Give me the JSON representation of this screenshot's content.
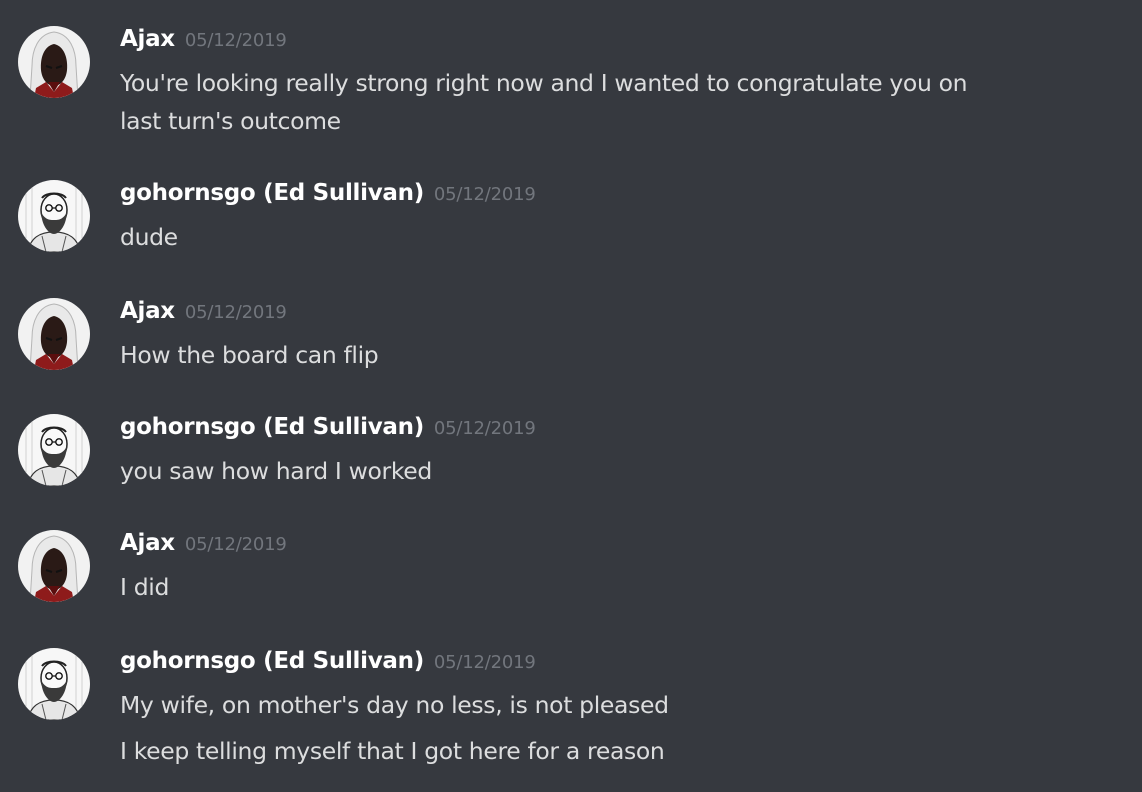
{
  "messages": [
    {
      "author": "Ajax",
      "avatar_icon": "hooded-assassin-avatar",
      "timestamp": "05/12/2019",
      "lines": [
        "You're looking really strong right now and I wanted to congratulate you on",
        "last turn's outcome"
      ]
    },
    {
      "author": "gohornsgo (Ed Sullivan)",
      "avatar_icon": "bearded-man-sketch-avatar",
      "timestamp": "05/12/2019",
      "lines": [
        "dude"
      ]
    },
    {
      "author": "Ajax",
      "avatar_icon": "hooded-assassin-avatar",
      "timestamp": "05/12/2019",
      "lines": [
        "How the board can flip"
      ]
    },
    {
      "author": "gohornsgo (Ed Sullivan)",
      "avatar_icon": "bearded-man-sketch-avatar",
      "timestamp": "05/12/2019",
      "lines": [
        "you saw how hard I worked"
      ]
    },
    {
      "author": "Ajax",
      "avatar_icon": "hooded-assassin-avatar",
      "timestamp": "05/12/2019",
      "lines": [
        "I did"
      ]
    },
    {
      "author": "gohornsgo (Ed Sullivan)",
      "avatar_icon": "bearded-man-sketch-avatar",
      "timestamp": "05/12/2019",
      "lines": [
        "My wife, on mother's day no less, is not pleased",
        "I keep telling myself that I got here for a reason"
      ]
    }
  ],
  "colors": {
    "background": "#36393f",
    "author": "#ffffff",
    "timestamp": "#72767d",
    "message_text": "#dcddde"
  }
}
